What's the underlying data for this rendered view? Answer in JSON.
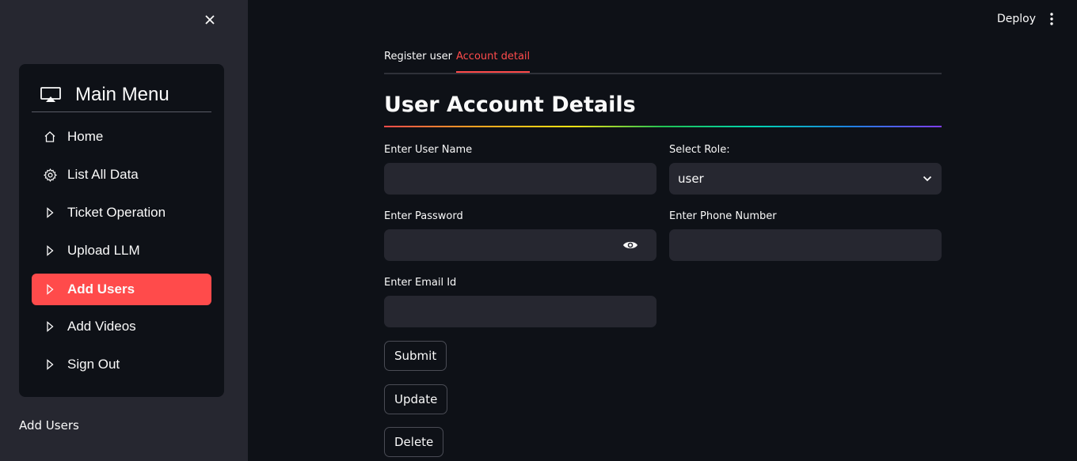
{
  "sidebar": {
    "menu_title": "Main Menu",
    "items": [
      {
        "label": "Home",
        "icon": "home-icon"
      },
      {
        "label": "List All Data",
        "icon": "gear-icon"
      },
      {
        "label": "Ticket Operation",
        "icon": "caret-right-icon"
      },
      {
        "label": "Upload LLM",
        "icon": "caret-right-icon"
      },
      {
        "label": "Add Users",
        "icon": "caret-right-icon",
        "active": true
      },
      {
        "label": "Add Videos",
        "icon": "caret-right-icon"
      },
      {
        "label": "Sign Out",
        "icon": "caret-right-icon"
      }
    ],
    "footer_text": "Add Users"
  },
  "header": {
    "deploy_label": "Deploy"
  },
  "tabs": [
    {
      "label": "Register user",
      "active": false
    },
    {
      "label": "Account detail",
      "active": true
    }
  ],
  "form": {
    "title": "User Account Details",
    "username_label": "Enter User Name",
    "username_value": "",
    "role_label": "Select Role:",
    "role_value": "user",
    "password_label": "Enter Password",
    "password_value": "",
    "phone_label": "Enter Phone Number",
    "phone_value": "",
    "email_label": "Enter Email Id",
    "email_value": ""
  },
  "buttons": {
    "submit": "Submit",
    "update": "Update",
    "delete": "Delete"
  },
  "colors": {
    "accent": "#ff4b4b",
    "background": "#0e1117",
    "sidebar": "#262730"
  }
}
